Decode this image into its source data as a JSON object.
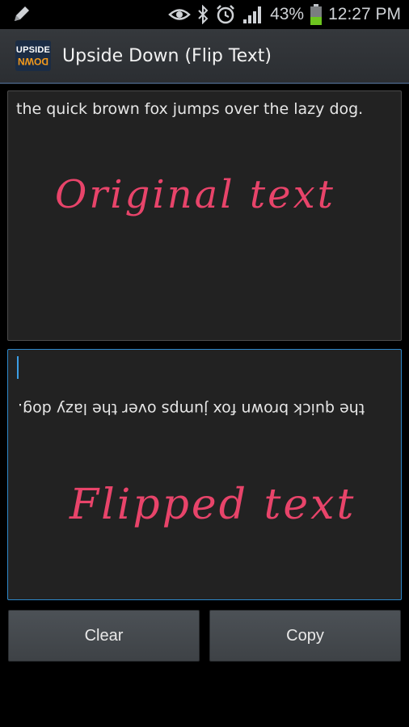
{
  "status_bar": {
    "battery_percent": "43%",
    "battery_level": 0.43,
    "time": "12:27 PM",
    "icons": [
      "pencil-icon",
      "eye-icon",
      "bluetooth-icon",
      "alarm-icon",
      "signal-icon",
      "battery-icon"
    ]
  },
  "app": {
    "icon_top": "UPSIDE",
    "icon_bottom": "DOWN",
    "title": "Upside Down (Flip Text)"
  },
  "original": {
    "text": "the quick brown fox jumps over the lazy dog.",
    "annotation": "Original text"
  },
  "flipped": {
    "text": "the quick brown fox jumps over the lazy dog.",
    "annotation": "Flipped text"
  },
  "buttons": {
    "clear": "Clear",
    "copy": "Copy"
  },
  "colors": {
    "accent": "#2e88c9",
    "annotation": "#e8446a",
    "battery_fill": "#6dc51f"
  }
}
